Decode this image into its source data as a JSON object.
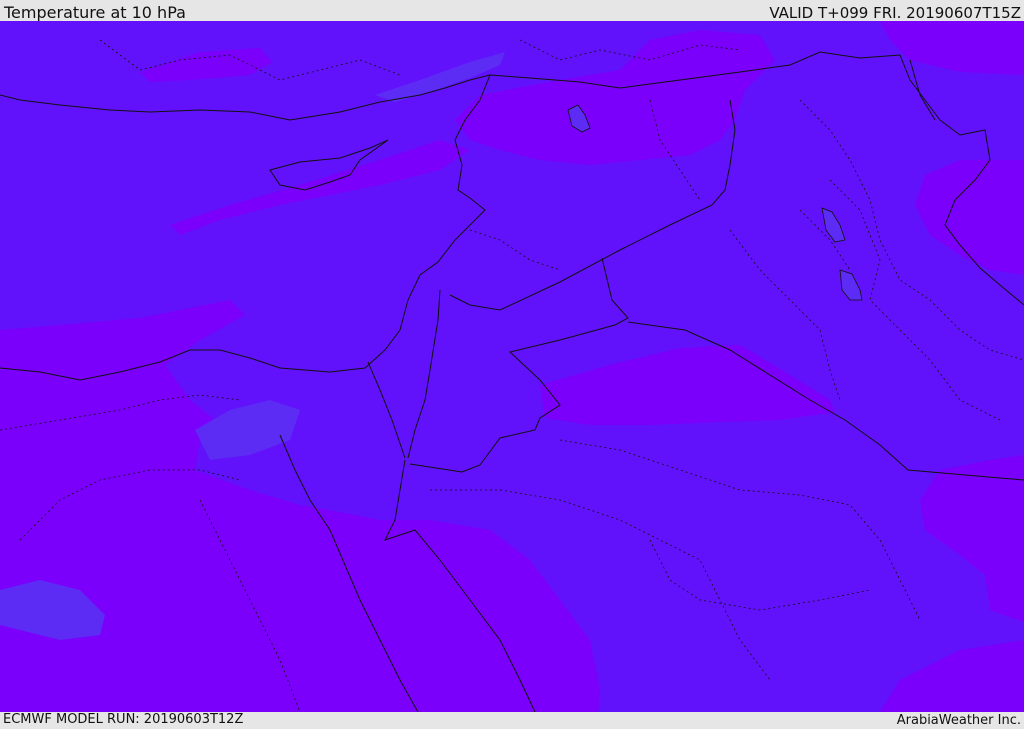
{
  "header": {
    "title": "Temperature at 10 hPa",
    "valid": "VALID T+099 FRI. 20190607T15Z"
  },
  "footer": {
    "model_run": "ECMWF MODEL RUN: 20190603T12Z",
    "credit": "ArabiaWeather Inc."
  },
  "colors": {
    "base": "#6212fb",
    "warm": "#7b00fb",
    "cool": "#5c2cf4",
    "border": "#111111"
  }
}
